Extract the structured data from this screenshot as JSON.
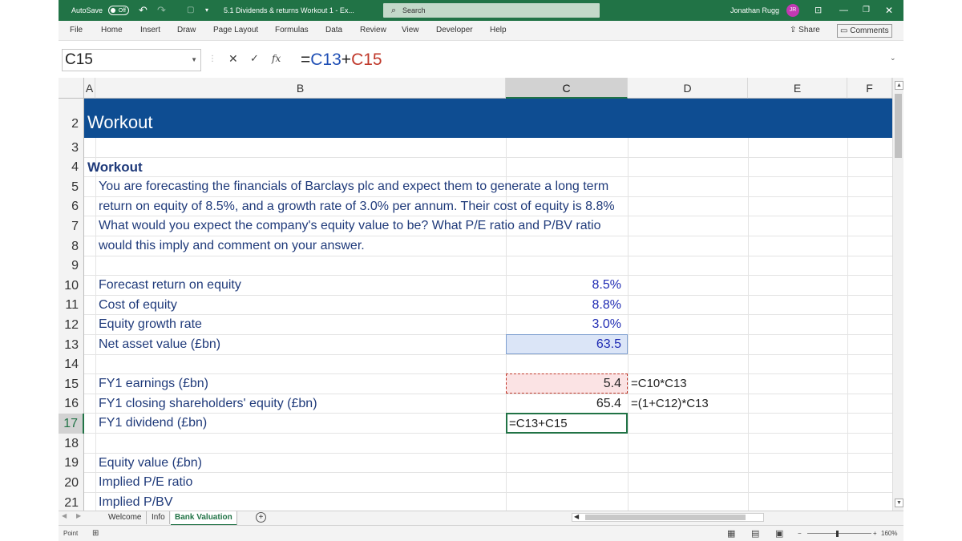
{
  "title_bar": {
    "autosave_label": "AutoSave",
    "autosave_state": "Off",
    "document_title": "5.1 Dividends & returns Workout 1  -  Ex...",
    "search_placeholder": "Search",
    "user_name": "Jonathan Rugg",
    "user_initials": "JR"
  },
  "ribbon": {
    "tabs": [
      "File",
      "Home",
      "Insert",
      "Draw",
      "Page Layout",
      "Formulas",
      "Data",
      "Review",
      "View",
      "Developer",
      "Help"
    ],
    "share_label": "Share",
    "comments_label": "Comments"
  },
  "formula_bar": {
    "name_box": "C15",
    "formula_prefix": "=",
    "formula_ref1": "C13",
    "formula_op": "+",
    "formula_ref2": "C15",
    "fx_label": "fx"
  },
  "columns": [
    "A",
    "B",
    "C",
    "D",
    "E",
    "F"
  ],
  "rows": [
    "2",
    "3",
    "4",
    "5",
    "6",
    "7",
    "8",
    "9",
    "10",
    "11",
    "12",
    "13",
    "14",
    "15",
    "16",
    "17",
    "18",
    "19",
    "20",
    "21"
  ],
  "sheet": {
    "banner_title": "Workout",
    "section_title": "Workout",
    "question_lines": [
      "You are forecasting the financials of Barclays plc and expect them to generate a long term",
      "return on equity of 8.5%, and a growth rate of 3.0% per annum. Their cost of equity is 8.8%",
      "What would you expect the company's equity value to be? What P/E ratio and P/BV ratio",
      "would this imply and comment on your answer."
    ],
    "labels": {
      "r10": "Forecast return on equity",
      "r11": "Cost of equity",
      "r12": "Equity growth rate",
      "r13": "Net asset value (£bn)",
      "r15": "FY1 earnings (£bn)",
      "r16": "FY1 closing shareholders' equity (£bn)",
      "r17": "FY1 dividend (£bn)",
      "r19": "Equity value (£bn)",
      "r20": "Implied P/E ratio",
      "r21": "Implied P/BV"
    },
    "values": {
      "c10": "8.5%",
      "c11": "8.8%",
      "c12": "3.0%",
      "c13": "63.5",
      "c15": "5.4",
      "c16": "65.4"
    },
    "editing_cell_text": "=C13+C15",
    "formulas": {
      "d15": "=C10*C13",
      "d16": "=(1+C12)*C13"
    }
  },
  "sheet_tabs": [
    "Welcome",
    "Info",
    "Bank Valuation"
  ],
  "active_sheet_tab": "Bank Valuation",
  "status_bar": {
    "mode": "Point",
    "zoom": "160%"
  }
}
